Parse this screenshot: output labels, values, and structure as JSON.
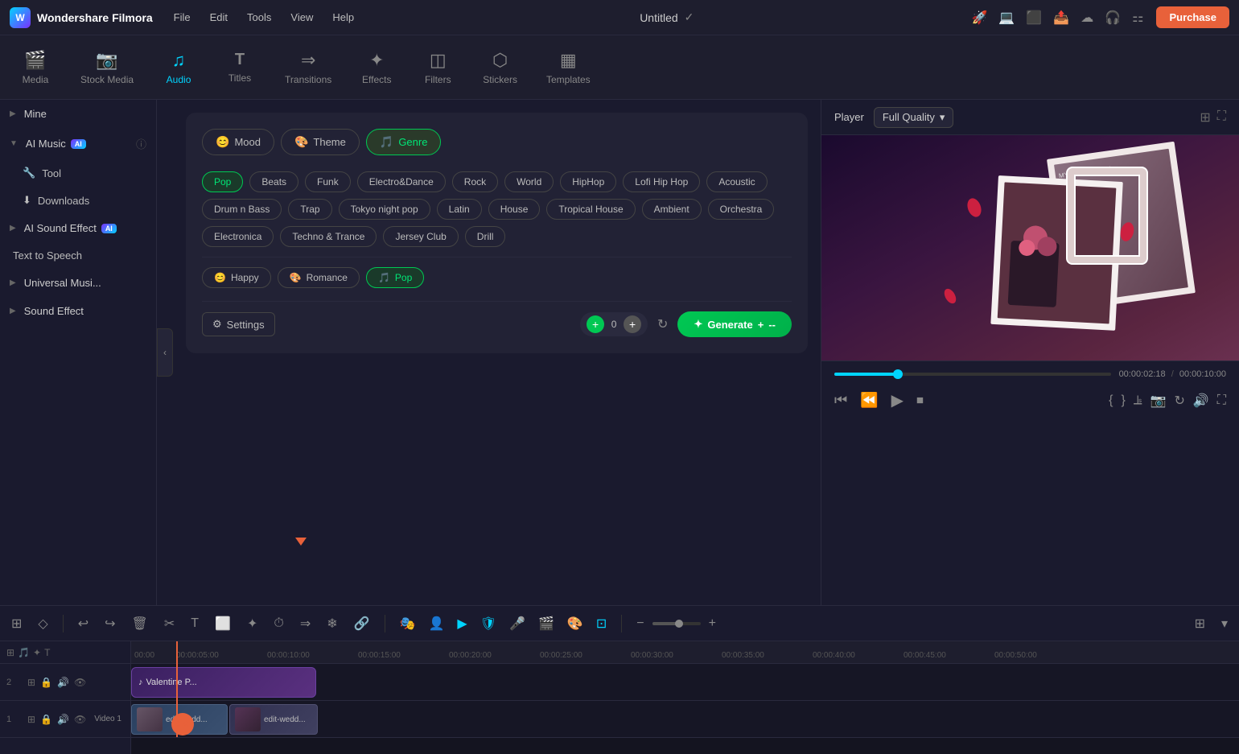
{
  "app": {
    "name": "Wondershare Filmora",
    "title": "Untitled",
    "logo_letter": "W"
  },
  "titlebar": {
    "menu": [
      "File",
      "Edit",
      "Tools",
      "View",
      "Help"
    ],
    "purchase_label": "Purchase"
  },
  "tabs": [
    {
      "id": "media",
      "label": "Media",
      "icon": "🎬"
    },
    {
      "id": "stock",
      "label": "Stock Media",
      "icon": "📷"
    },
    {
      "id": "audio",
      "label": "Audio",
      "icon": "🎵",
      "active": true
    },
    {
      "id": "titles",
      "label": "Titles",
      "icon": "T"
    },
    {
      "id": "transitions",
      "label": "Transitions",
      "icon": "▶"
    },
    {
      "id": "effects",
      "label": "Effects",
      "icon": "✨"
    },
    {
      "id": "filters",
      "label": "Filters",
      "icon": "🔲"
    },
    {
      "id": "stickers",
      "label": "Stickers",
      "icon": "⭐"
    },
    {
      "id": "templates",
      "label": "Templates",
      "icon": "📋"
    }
  ],
  "sidebar": {
    "sections": [
      {
        "id": "mine",
        "label": "Mine",
        "collapsed": true,
        "has_ai": false
      },
      {
        "id": "ai-music",
        "label": "AI Music",
        "collapsed": false,
        "has_ai": true
      },
      {
        "id": "ai-sound-effect",
        "label": "AI Sound Effect",
        "collapsed": true,
        "has_ai": true
      },
      {
        "id": "text-to-speech",
        "label": "Text to Speech",
        "collapsed": false,
        "is_item": true
      },
      {
        "id": "universal-music",
        "label": "Universal Musi...",
        "collapsed": true,
        "has_ai": false
      },
      {
        "id": "sound-effect",
        "label": "Sound Effect",
        "collapsed": true,
        "has_ai": false
      }
    ],
    "sub_items": [
      {
        "id": "tool",
        "label": "Tool",
        "icon": "🔧"
      },
      {
        "id": "downloads",
        "label": "Downloads",
        "icon": "⬇"
      }
    ]
  },
  "ai_panel": {
    "tabs": [
      {
        "id": "mood",
        "label": "Mood",
        "icon": "😊",
        "active": false
      },
      {
        "id": "theme",
        "label": "Theme",
        "icon": "🎨",
        "active": false
      },
      {
        "id": "genre",
        "label": "Genre",
        "icon": "🎵",
        "active": true
      }
    ],
    "genres": [
      {
        "id": "pop",
        "label": "Pop",
        "selected": true
      },
      {
        "id": "beats",
        "label": "Beats",
        "selected": false
      },
      {
        "id": "funk",
        "label": "Funk",
        "selected": false
      },
      {
        "id": "electro-dance",
        "label": "Electro&Dance",
        "selected": false
      },
      {
        "id": "rock",
        "label": "Rock",
        "selected": false
      },
      {
        "id": "world",
        "label": "World",
        "selected": false
      },
      {
        "id": "hiphop",
        "label": "HipHop",
        "selected": false
      },
      {
        "id": "lofi-hip-hop",
        "label": "Lofi Hip Hop",
        "selected": false
      },
      {
        "id": "acoustic",
        "label": "Acoustic",
        "selected": false
      },
      {
        "id": "drum-n-bass",
        "label": "Drum n Bass",
        "selected": false
      },
      {
        "id": "trap",
        "label": "Trap",
        "selected": false
      },
      {
        "id": "tokyo-night-pop",
        "label": "Tokyo night pop",
        "selected": false
      },
      {
        "id": "latin",
        "label": "Latin",
        "selected": false
      },
      {
        "id": "house",
        "label": "House",
        "selected": false
      },
      {
        "id": "tropical-house",
        "label": "Tropical House",
        "selected": false
      },
      {
        "id": "ambient",
        "label": "Ambient",
        "selected": false
      },
      {
        "id": "orchestra",
        "label": "Orchestra",
        "selected": false
      },
      {
        "id": "electronica",
        "label": "Electronica",
        "selected": false
      },
      {
        "id": "techno-trance",
        "label": "Techno & Trance",
        "selected": false
      },
      {
        "id": "jersey-club",
        "label": "Jersey Club",
        "selected": false
      },
      {
        "id": "drill",
        "label": "Drill",
        "selected": false
      }
    ],
    "selected_tags": [
      {
        "id": "happy",
        "label": "Happy",
        "icon": "😊",
        "active": false
      },
      {
        "id": "romance",
        "label": "Romance",
        "icon": "🎨",
        "active": false
      },
      {
        "id": "pop",
        "label": "Pop",
        "icon": "🎵",
        "active": true
      }
    ],
    "settings_label": "Settings",
    "generate_label": "Generate",
    "add_count": "0"
  },
  "player": {
    "label": "Player",
    "quality": "Full Quality",
    "current_time": "00:00:02:18",
    "total_time": "00:00:10:00"
  },
  "timeline": {
    "ruler_marks": [
      "00:00:00",
      "00:00:05:00",
      "00:00:10:00",
      "00:00:15:00",
      "00:00:20:00",
      "00:00:25:00",
      "00:00:30:00",
      "00:00:35:00",
      "00:00:40:00",
      "00:00:45:00",
      "00:00:50:00"
    ],
    "tracks": [
      {
        "id": "track-1",
        "num": "2",
        "clip_label": "Valentine P..."
      },
      {
        "id": "track-2",
        "num": "1",
        "clip_label": "Video 1"
      }
    ],
    "video1_label": "Video 1"
  }
}
